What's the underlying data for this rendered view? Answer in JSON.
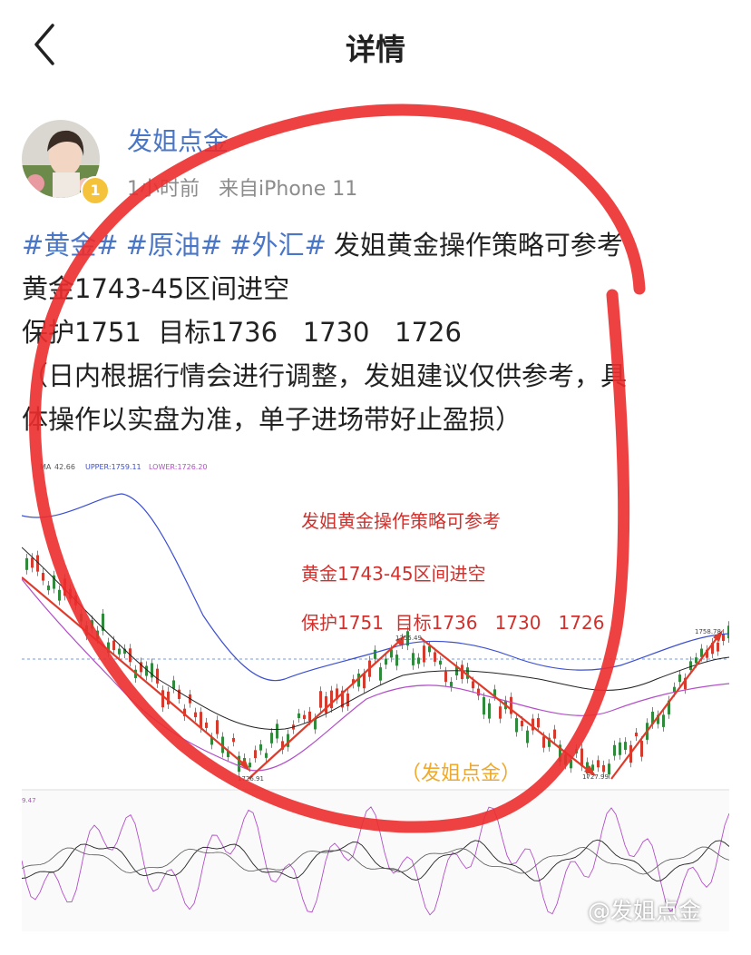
{
  "nav": {
    "title": "详情",
    "back_icon": "chevron-left-icon"
  },
  "author": {
    "name": "发姐点金",
    "level": "1",
    "time": "1小时前",
    "source": "来自iPhone 11"
  },
  "post": {
    "tags": [
      "#黄金#",
      "#原油#",
      "#外汇#"
    ],
    "headline": "发姐黄金操作策略可参考",
    "line2": "黄金1743-45区间进空",
    "line3": "保护1751  目标1736   1730   1726",
    "line4": "（日内根据行情会进行调整，发姐建议仅供参考，具",
    "line5": "体操作以实盘为准，单子进场带好止盈损）"
  },
  "chart_image": {
    "top_labels": [
      "MA",
      "42.66",
      "UPPER:1759.11",
      "LOWER:1726.20"
    ],
    "annotations": [
      "发姐黄金操作策略可参考",
      "黄金1743-45区间进空",
      "保护1751  目标1736   1730   1726"
    ],
    "point_labels": [
      "1755.49",
      "1726.91",
      "1727.99",
      "1758.78"
    ],
    "watermark_center": "（发姐点金）",
    "indicator_label": "9.47",
    "colors": {
      "candle_up": "#d23b2e",
      "candle_down": "#2f8a3c",
      "band": "#3c4fd0",
      "lower_band": "#b34fc9",
      "arrow": "#e03a2a"
    }
  },
  "watermark": "@发姐点金"
}
